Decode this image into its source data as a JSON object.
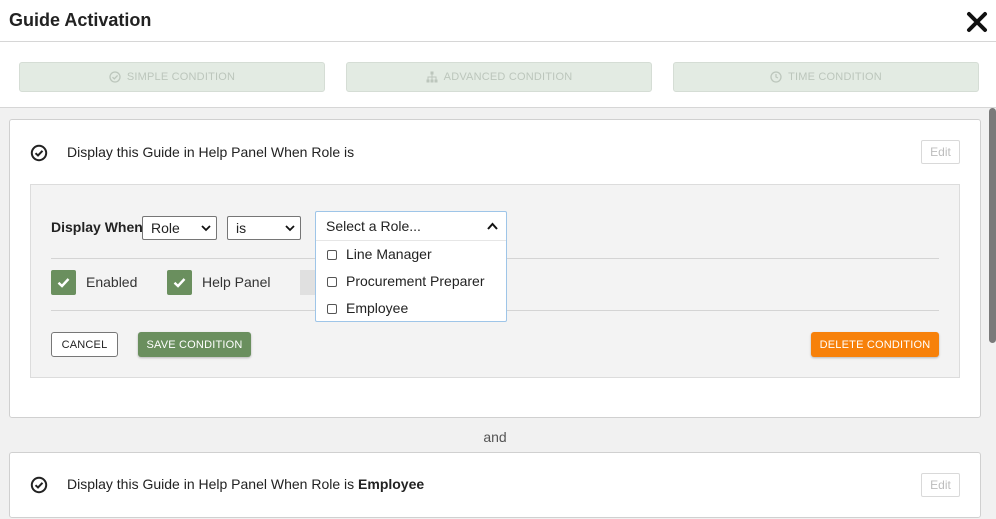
{
  "header": {
    "title": "Guide Activation",
    "close_icon": "close-icon"
  },
  "tabs": [
    {
      "label": "SIMPLE CONDITION",
      "icon": "check-circle-icon"
    },
    {
      "label": "ADVANCED CONDITION",
      "icon": "sitemap-icon"
    },
    {
      "label": "TIME CONDITION",
      "icon": "clock-icon"
    }
  ],
  "conditions": [
    {
      "text": "Display this Guide in Help Panel When Role is",
      "value": "",
      "edit_label": "Edit"
    },
    {
      "text": "Display this Guide in Help Panel When Role is",
      "value": "Employee",
      "edit_label": "Edit"
    }
  ],
  "editor": {
    "display_when_label": "Display When",
    "field_select": "Role",
    "operator_select": "is",
    "role_dropdown": {
      "placeholder": "Select a Role...",
      "options": [
        "Line Manager",
        "Procurement Preparer",
        "Employee"
      ]
    },
    "enabled_label": "Enabled",
    "help_panel_label": "Help Panel",
    "cancel_label": "CANCEL",
    "save_label": "SAVE CONDITION",
    "delete_label": "DELETE CONDITION"
  },
  "connector": "and",
  "colors": {
    "green": "#6a8f5e",
    "orange": "#f7810a",
    "tab_bg": "#e3ebe3"
  }
}
